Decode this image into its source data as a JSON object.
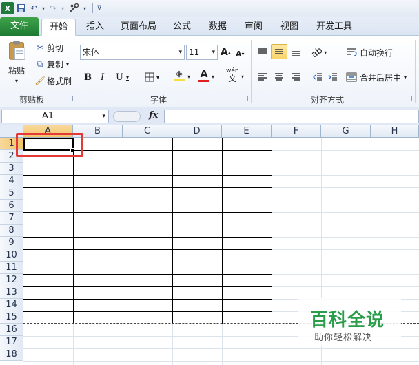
{
  "quick_access": {
    "app_icon": "X",
    "save_icon": "save-icon",
    "undo_icon": "undo-icon",
    "redo_icon": "redo-icon",
    "tool_icon": "tool-icon"
  },
  "tabs": [
    {
      "label": "文件"
    },
    {
      "label": "开始"
    },
    {
      "label": "插入"
    },
    {
      "label": "页面布局"
    },
    {
      "label": "公式"
    },
    {
      "label": "数据"
    },
    {
      "label": "审阅"
    },
    {
      "label": "视图"
    },
    {
      "label": "开发工具"
    }
  ],
  "clipboard": {
    "paste_label": "粘贴",
    "cut_label": "剪切",
    "copy_label": "复制",
    "format_painter_label": "格式刷",
    "group_label": "剪贴板"
  },
  "font": {
    "font_name": "宋体",
    "font_size": "11",
    "bold": "B",
    "italic": "I",
    "underline": "U",
    "grow": "A",
    "shrink": "A",
    "font_color_glyph": "A",
    "wen": "wén",
    "wen_char": "文",
    "group_label": "字体"
  },
  "alignment": {
    "wrap_text_label": "自动换行",
    "merge_center_label": "合并后居中",
    "group_label": "对齐方式"
  },
  "formula_bar": {
    "name_box": "A1",
    "fx": "fx",
    "value": ""
  },
  "sheet": {
    "columns": [
      "A",
      "B",
      "C",
      "D",
      "E",
      "F",
      "G",
      "H"
    ],
    "rows": [
      "1",
      "2",
      "3",
      "4",
      "5",
      "6",
      "7",
      "8",
      "9",
      "10",
      "11",
      "12",
      "13",
      "14",
      "15",
      "16",
      "17",
      "18"
    ],
    "selected_cell": "A1"
  },
  "watermark": {
    "title": "百科全说",
    "subtitle": "助你轻松解决"
  },
  "colors": {
    "file_tab": "#1d7a33",
    "selection_header": "#f2c46a",
    "annotation_box": "#e53935",
    "watermark_text": "#2a9d4a"
  }
}
